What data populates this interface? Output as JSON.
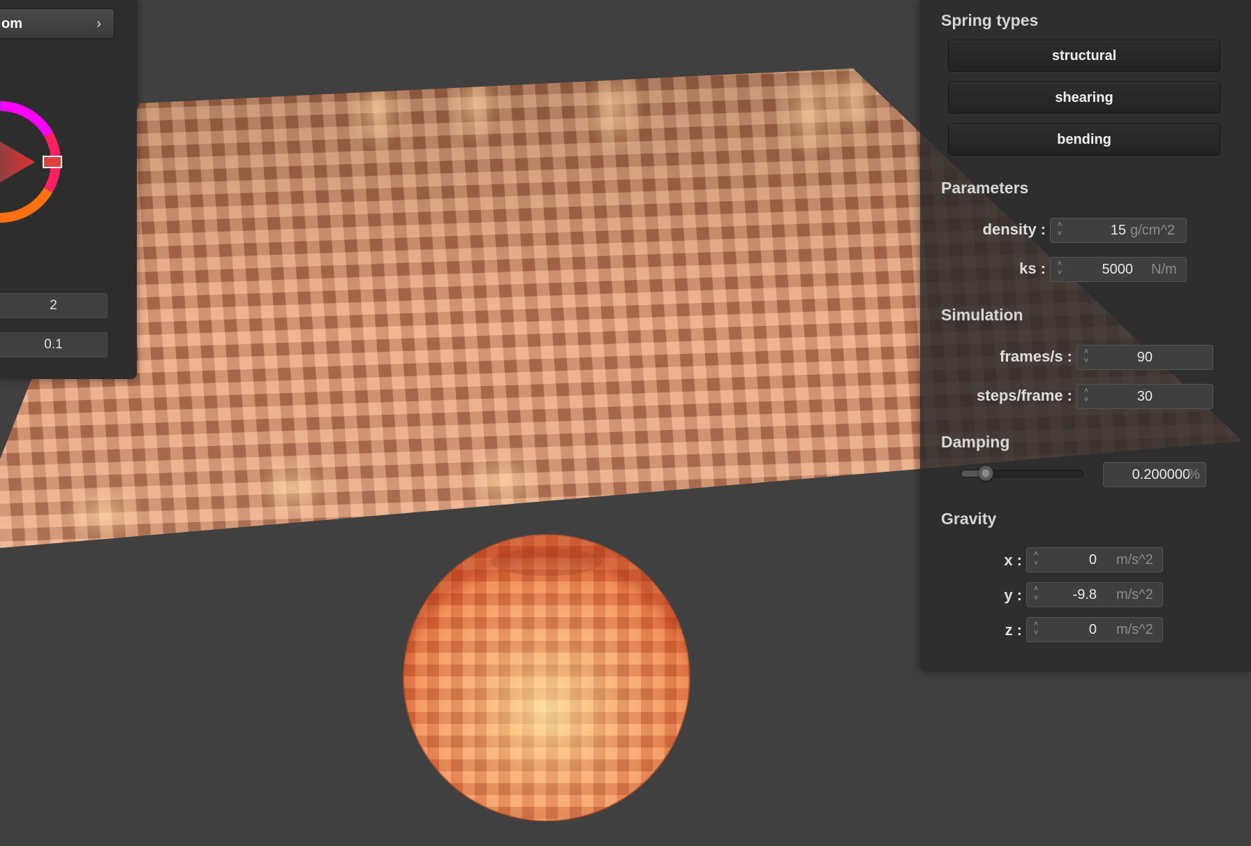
{
  "left_panel": {
    "dropdown_label": "om",
    "fields": [
      "2",
      "0.1"
    ]
  },
  "right_panel": {
    "spring_types": {
      "title": "Spring types",
      "buttons": [
        "structural",
        "shearing",
        "bending"
      ]
    },
    "parameters": {
      "title": "Parameters",
      "density": {
        "label": "density :",
        "value": "15",
        "unit": "g/cm^2"
      },
      "ks": {
        "label": "ks :",
        "value": "5000",
        "unit": "N/m"
      }
    },
    "simulation": {
      "title": "Simulation",
      "fps": {
        "label": "frames/s :",
        "value": "90"
      },
      "steps": {
        "label": "steps/frame :",
        "value": "30"
      }
    },
    "damping": {
      "title": "Damping",
      "slider_fraction": 0.2,
      "value": "0.200000",
      "unit": "%"
    },
    "gravity": {
      "title": "Gravity",
      "x": {
        "label": "x :",
        "value": "0",
        "unit": "m/s^2"
      },
      "y": {
        "label": "y :",
        "value": "-9.8",
        "unit": "m/s^2"
      },
      "z": {
        "label": "z :",
        "value": "0",
        "unit": "m/s^2"
      }
    }
  },
  "colors": {
    "background": "#404040",
    "panel": "#2b2b2b",
    "cloth_light": "#f1b590",
    "cloth_dark": "#9c5a3c",
    "sphere_glow": "#ffd27a"
  },
  "icons": [
    "chevron-right-icon",
    "spin-arrows-icon",
    "slider-knob-icon"
  ]
}
